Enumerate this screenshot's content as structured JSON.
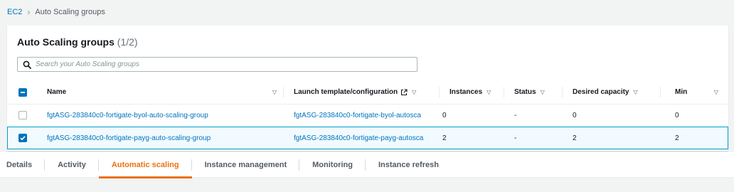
{
  "breadcrumb": {
    "parent": "EC2",
    "current": "Auto Scaling groups"
  },
  "panel": {
    "title": "Auto Scaling groups",
    "count": "(1/2)",
    "search_placeholder": "Search your Auto Scaling groups"
  },
  "columns": {
    "name": "Name",
    "launch_template": "Launch template/configuration",
    "instances": "Instances",
    "status": "Status",
    "desired_capacity": "Desired capacity",
    "min": "Min"
  },
  "rows": [
    {
      "selected": false,
      "name": "fgtASG-283840c0-fortigate-byol-auto-scaling-group",
      "launch_template": "fgtASG-283840c0-fortigate-byol-autosca",
      "instances": "0",
      "status": "-",
      "desired_capacity": "0",
      "min": "0"
    },
    {
      "selected": true,
      "name": "fgtASG-283840c0-fortigate-payg-auto-scaling-group",
      "launch_template": "fgtASG-283840c0-fortigate-payg-autosca",
      "instances": "2",
      "status": "-",
      "desired_capacity": "2",
      "min": "2"
    }
  ],
  "tabs": [
    {
      "label": "Details",
      "active": false
    },
    {
      "label": "Activity",
      "active": false
    },
    {
      "label": "Automatic scaling",
      "active": true
    },
    {
      "label": "Instance management",
      "active": false
    },
    {
      "label": "Monitoring",
      "active": false
    },
    {
      "label": "Instance refresh",
      "active": false
    }
  ],
  "colors": {
    "link": "#0073bb",
    "accent": "#ec7211",
    "selected_row": "#f1faff",
    "selected_border": "#00a1c9"
  }
}
